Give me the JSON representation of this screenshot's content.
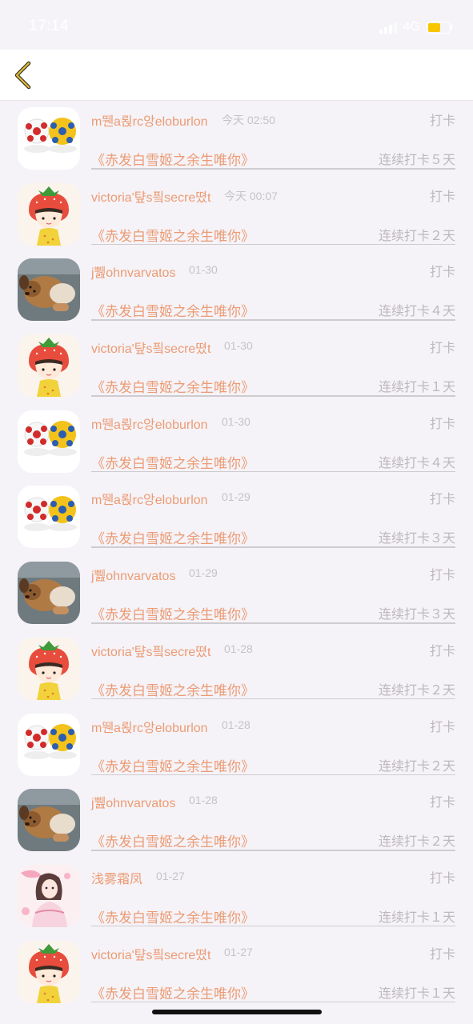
{
  "status_bar": {
    "time": "17:14",
    "network": "4G"
  },
  "colors": {
    "accent": "#ec9b73",
    "muted": "#bdb8bd",
    "background": "#f5f3f8"
  },
  "icons": {
    "back": "chevron-left-icon"
  },
  "entries": [
    {
      "avatar": "soccer-balls",
      "username": "m뛘a뢵rc앙eloburlon",
      "time": "今天 02:50",
      "action": "打卡",
      "book": "《赤发白雪姬之余生唯你》",
      "streak": "连续打卡５天"
    },
    {
      "avatar": "strawberry-girl",
      "username": "victoria'턒s픸secre뗬t",
      "time": "今天 00:07",
      "action": "打卡",
      "book": "《赤发白雪姬之余生唯你》",
      "streak": "连续打卡２天"
    },
    {
      "avatar": "dog",
      "username": "j쀒ohnvarvatos",
      "time": "01-30",
      "action": "打卡",
      "book": "《赤发白雪姬之余生唯你》",
      "streak": "连续打卡４天"
    },
    {
      "avatar": "strawberry-girl",
      "username": "victoria'턒s픸secre뗬t",
      "time": "01-30",
      "action": "打卡",
      "book": "《赤发白雪姬之余生唯你》",
      "streak": "连续打卡１天"
    },
    {
      "avatar": "soccer-balls",
      "username": "m뛘a뢵rc앙eloburlon",
      "time": "01-30",
      "action": "打卡",
      "book": "《赤发白雪姬之余生唯你》",
      "streak": "连续打卡４天"
    },
    {
      "avatar": "soccer-balls",
      "username": "m뛘a뢵rc앙eloburlon",
      "time": "01-29",
      "action": "打卡",
      "book": "《赤发白雪姬之余生唯你》",
      "streak": "连续打卡３天"
    },
    {
      "avatar": "dog",
      "username": "j쀒ohnvarvatos",
      "time": "01-29",
      "action": "打卡",
      "book": "《赤发白雪姬之余生唯你》",
      "streak": "连续打卡３天"
    },
    {
      "avatar": "strawberry-girl",
      "username": "victoria'턒s픸secre뗬t",
      "time": "01-28",
      "action": "打卡",
      "book": "《赤发白雪姬之余生唯你》",
      "streak": "连续打卡２天"
    },
    {
      "avatar": "soccer-balls",
      "username": "m뛘a뢵rc앙eloburlon",
      "time": "01-28",
      "action": "打卡",
      "book": "《赤发白雪姬之余生唯你》",
      "streak": "连续打卡２天"
    },
    {
      "avatar": "dog",
      "username": "j쀒ohnvarvatos",
      "time": "01-28",
      "action": "打卡",
      "book": "《赤发白雪姬之余生唯你》",
      "streak": "连续打卡２天"
    },
    {
      "avatar": "anime-girl",
      "username": "浅雾霜凤",
      "time": "01-27",
      "action": "打卡",
      "book": "《赤发白雪姬之余生唯你》",
      "streak": "连续打卡１天"
    },
    {
      "avatar": "strawberry-girl",
      "username": "victoria'턒s픸secre뗬t",
      "time": "01-27",
      "action": "打卡",
      "book": "《赤发白雪姬之余生唯你》",
      "streak": "连续打卡１天"
    }
  ]
}
